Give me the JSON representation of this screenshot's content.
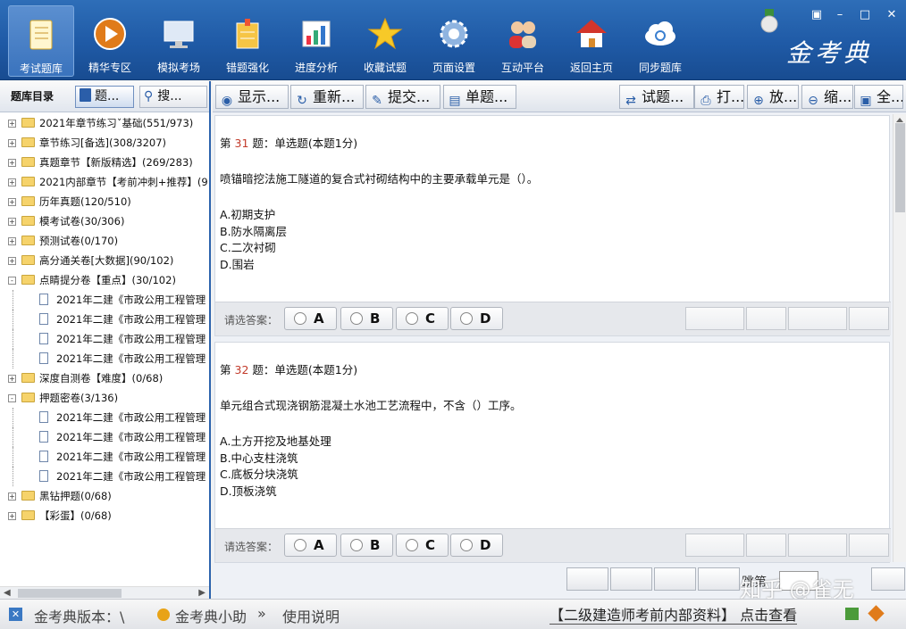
{
  "brand": {
    "logo_text": "金考典"
  },
  "window_controls": [
    "▣",
    "–",
    "□",
    "✕"
  ],
  "nav": [
    {
      "label": "考试题库",
      "icon": "book-icon",
      "active": true
    },
    {
      "label": "精华专区",
      "icon": "play-icon",
      "active": false
    },
    {
      "label": "模拟考场",
      "icon": "monitor-icon",
      "active": false
    },
    {
      "label": "错题强化",
      "icon": "notes-icon",
      "active": false
    },
    {
      "label": "进度分析",
      "icon": "chart-icon",
      "active": false
    },
    {
      "label": "收藏试题",
      "icon": "star-icon",
      "active": false
    },
    {
      "label": "页面设置",
      "icon": "gear-icon",
      "active": false
    },
    {
      "label": "互动平台",
      "icon": "users-icon",
      "active": false
    },
    {
      "label": "返回主页",
      "icon": "home-icon",
      "active": false
    },
    {
      "label": "同步题库",
      "icon": "cloud-sync-icon",
      "active": false
    }
  ],
  "left_panel": {
    "title": "题库目录",
    "tab_question_bank": "题...",
    "tab_search": "搜...",
    "tree": [
      {
        "label": "2021年章节练习ˇ基础(551/973)",
        "level": 0,
        "type": "folder",
        "expand": "+"
      },
      {
        "label": "章节练习[备选](308/3207)",
        "level": 0,
        "type": "folder",
        "expand": "+"
      },
      {
        "label": "真题章节【新版精选】(269/283)",
        "level": 0,
        "type": "folder",
        "expand": "+"
      },
      {
        "label": "2021内部章节【考前冲刺+推荐】(9",
        "level": 0,
        "type": "folder",
        "expand": "+"
      },
      {
        "label": "历年真题(120/510)",
        "level": 0,
        "type": "folder",
        "expand": "+"
      },
      {
        "label": "模考试卷(30/306)",
        "level": 0,
        "type": "folder",
        "expand": "+"
      },
      {
        "label": "预测试卷(0/170)",
        "level": 0,
        "type": "folder",
        "expand": "+"
      },
      {
        "label": "高分通关卷[大数据](90/102)",
        "level": 0,
        "type": "folder",
        "expand": "+"
      },
      {
        "label": "点睛提分卷【重点】(30/102)",
        "level": 0,
        "type": "folder",
        "expand": "-"
      },
      {
        "label": "2021年二建《市政公用工程管理",
        "level": 1,
        "type": "doc"
      },
      {
        "label": "2021年二建《市政公用工程管理",
        "level": 1,
        "type": "doc"
      },
      {
        "label": "2021年二建《市政公用工程管理",
        "level": 1,
        "type": "doc"
      },
      {
        "label": "2021年二建《市政公用工程管理",
        "level": 1,
        "type": "doc"
      },
      {
        "label": "深度自测卷【难度】(0/68)",
        "level": 0,
        "type": "folder",
        "expand": "+"
      },
      {
        "label": "押题密卷(3/136)",
        "level": 0,
        "type": "folder",
        "expand": "-"
      },
      {
        "label": "2021年二建《市政公用工程管理",
        "level": 1,
        "type": "doc"
      },
      {
        "label": "2021年二建《市政公用工程管理",
        "level": 1,
        "type": "doc"
      },
      {
        "label": "2021年二建《市政公用工程管理",
        "level": 1,
        "type": "doc"
      },
      {
        "label": "2021年二建《市政公用工程管理",
        "level": 1,
        "type": "doc"
      },
      {
        "label": "黑钻押题(0/68)",
        "level": 0,
        "type": "folder",
        "expand": "+"
      },
      {
        "label": "【彩蛋】(0/68)",
        "level": 0,
        "type": "folder",
        "expand": "+"
      }
    ]
  },
  "toolbar": [
    {
      "label": "显示...",
      "icon": "eye-icon",
      "glyph": "◉"
    },
    {
      "label": "重新...",
      "icon": "refresh-icon",
      "glyph": "↻"
    },
    {
      "label": "提交...",
      "icon": "submit-icon",
      "glyph": "✎"
    },
    {
      "label": "单题...",
      "icon": "page-icon",
      "glyph": "▤"
    },
    {
      "label": "试题...",
      "icon": "swap-icon",
      "glyph": "⇄"
    },
    {
      "label": "打...",
      "icon": "printer-icon",
      "glyph": "⎙"
    },
    {
      "label": "放...",
      "icon": "zoom-in-icon",
      "glyph": "⊕"
    },
    {
      "label": "缩...",
      "icon": "zoom-out-icon",
      "glyph": "⊖"
    },
    {
      "label": "全...",
      "icon": "fullscreen-icon",
      "glyph": "▣"
    }
  ],
  "questions": [
    {
      "prefix": "第",
      "number": "31",
      "suffix": "题：单选题(本题1分)",
      "stem": "喷锚暗挖法施工隧道的复合式衬砌结构中的主要承载单元是（）。",
      "options": [
        "A.初期支护",
        "B.防水隔离层",
        "C.二次衬砌",
        "D.围岩"
      ],
      "answer_label": "请选答案：",
      "choices": [
        "A",
        "B",
        "C",
        "D"
      ]
    },
    {
      "prefix": "第",
      "number": "32",
      "suffix": "题：单选题(本题1分)",
      "stem": "单元组合式现浇钢筋混凝土水池工艺流程中，不含（）工序。",
      "options": [
        "A.土方开挖及地基处理",
        "B.中心支柱浇筑",
        "C.底板分块浇筑",
        "D.顶板浇筑"
      ],
      "answer_label": "请选答案：",
      "choices": [
        "A",
        "B",
        "C",
        "D"
      ]
    }
  ],
  "pager": {
    "jump_label": "跳第",
    "watermark": "知乎 @雀无"
  },
  "status_bar": {
    "version": "金考典版本：\\",
    "assistant": "金考典小助",
    "more": "»",
    "manual": "使用说明",
    "promo": "【二级建造师考前内部资料】 点击查看"
  },
  "colors": {
    "header": "#1f5aa6",
    "accent": "#2c63ad",
    "question_number": "#c23a2a"
  }
}
